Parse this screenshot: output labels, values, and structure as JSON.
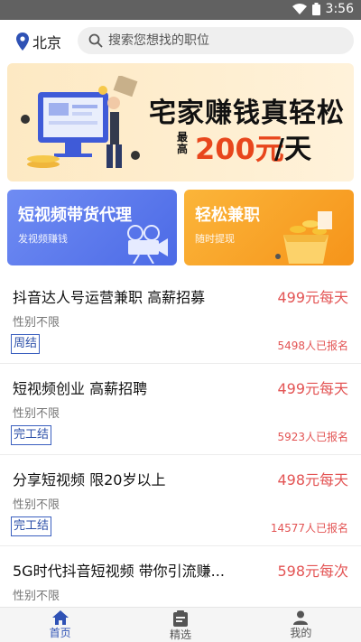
{
  "status_bar": {
    "time": "3:56",
    "wifi_icon": "wifi-icon",
    "battery_icon": "battery-icon"
  },
  "header": {
    "location_icon": "location-pin-icon",
    "city": "北京",
    "search_icon": "search-icon",
    "search_placeholder": "搜索您想找的职位"
  },
  "banner": {
    "headline": "宅家赚钱真轻松",
    "max_label": "最高",
    "amount": "200元",
    "per_day": "/天",
    "active_index": 0,
    "slide_count": 2
  },
  "feature_cards": [
    {
      "title": "短视频带货代理",
      "subtitle": "发视频赚钱",
      "icon": "film-camera-icon",
      "color": "#5b79ee"
    },
    {
      "title": "轻松兼职",
      "subtitle": "随时提现",
      "icon": "coin-box-icon",
      "color": "#f7a02a"
    }
  ],
  "jobs": [
    {
      "title": "抖音达人号运营兼职 高薪招募",
      "pay": "499元每天",
      "gender": "性别不限",
      "tag": "周结",
      "signups": "5498人已报名"
    },
    {
      "title": "短视频创业  高薪招聘",
      "pay": "499元每天",
      "gender": "性别不限",
      "tag": "完工结",
      "signups": "5923人已报名"
    },
    {
      "title": "分享短视频 限20岁以上",
      "pay": "498元每天",
      "gender": "性别不限",
      "tag": "完工结",
      "signups": "14577人已报名"
    },
    {
      "title": "5G时代抖音短视频 带你引流赚...",
      "pay": "598元每次",
      "gender": "性别不限",
      "tag": "",
      "signups": ""
    }
  ],
  "tabs": [
    {
      "label": "首页",
      "icon": "home-icon",
      "active": true
    },
    {
      "label": "精选",
      "icon": "clipboard-icon",
      "active": false
    },
    {
      "label": "我的",
      "icon": "user-icon",
      "active": false
    }
  ],
  "colors": {
    "accent": "#2f52b5",
    "price": "#e35454",
    "banner_amount": "#e8461c"
  }
}
